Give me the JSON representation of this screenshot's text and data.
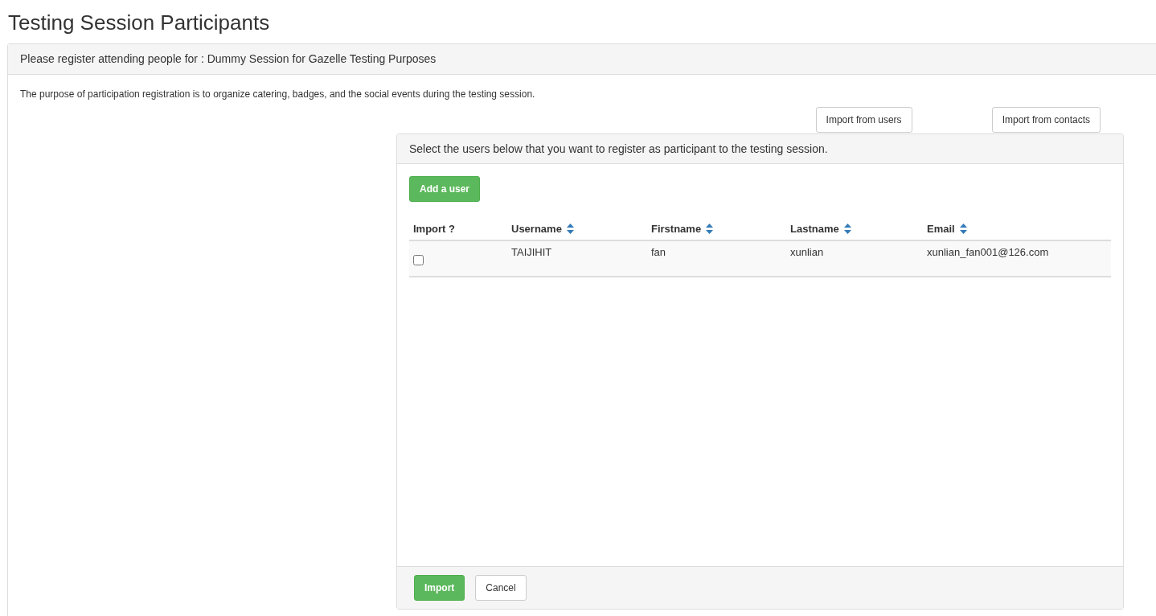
{
  "page_title": "Testing Session Participants",
  "panel": {
    "heading": "Please register attending people for : Dummy Session for Gazelle Testing Purposes",
    "description": "The purpose of participation registration is to organize catering, badges, and the social events during the testing session."
  },
  "import_buttons": [
    "Import from users",
    "Import from contacts"
  ],
  "dialog": {
    "heading": "Select the users below that you want to register as participant to the testing session.",
    "add_button": "Add a user",
    "table": {
      "columns": [
        {
          "label": "Import ?",
          "sortable": false
        },
        {
          "label": "Username",
          "sortable": true
        },
        {
          "label": "Firstname",
          "sortable": true
        },
        {
          "label": "Lastname",
          "sortable": true
        },
        {
          "label": "Email",
          "sortable": true
        }
      ],
      "rows": [
        {
          "cells": [
            {
              "kind": "checkbox",
              "checked": false
            },
            {
              "kind": "text",
              "text": "TAIJIHIT"
            },
            {
              "kind": "text",
              "text": "fan"
            },
            {
              "kind": "text",
              "text": "xunlian"
            },
            {
              "kind": "text",
              "text": "xunlian_fan001@126.com"
            }
          ]
        }
      ]
    },
    "footer_buttons": [
      {
        "label": "Import",
        "kind": "primary"
      },
      {
        "label": "Cancel",
        "kind": "default"
      }
    ]
  }
}
